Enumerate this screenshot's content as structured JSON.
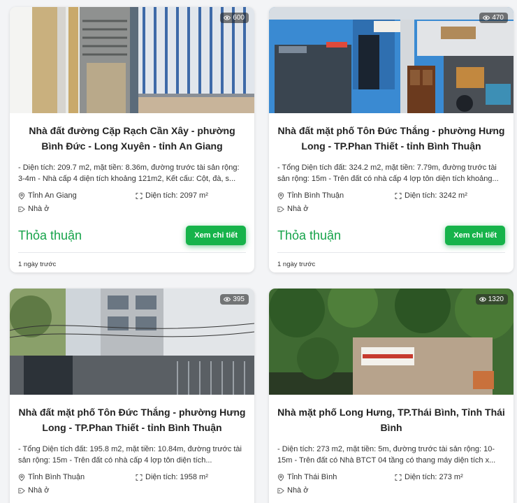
{
  "listings": [
    {
      "views": "600",
      "title": "Nhà đất đường Cặp Rạch Cần Xây - phường Bình Đức - Long Xuyên - tỉnh An Giang",
      "description": "- Diện tích: 209.7 m2, mặt tiền: 8.36m, đường trước tài sản rộng: 3-4m - Nhà cấp 4 diện tích khoảng 121m2, Kết cấu: Cột, đà, s...",
      "location": "Tỉnh An Giang",
      "area": "Diện tích: 2097 m²",
      "type": "Nhà ở",
      "price": "Thỏa thuận",
      "button": "Xem chi tiết",
      "time": "1 ngày trước"
    },
    {
      "views": "470",
      "title": "Nhà đất mặt phố Tôn Đức Thắng - phường Hưng Long - TP.Phan Thiết - tỉnh Bình Thuận",
      "description": "- Tổng Diện tích đất: 324.2 m2, mặt tiền: 7.79m, đường trước tài sản rộng: 15m - Trên đất có nhà cấp 4 lợp tôn diện tích khoảng...",
      "location": "Tỉnh Bình Thuận",
      "area": "Diện tích: 3242 m²",
      "type": "Nhà ở",
      "price": "Thỏa thuận",
      "button": "Xem chi tiết",
      "time": "1 ngày trước"
    },
    {
      "views": "395",
      "title": "Nhà đất mặt phố Tôn Đức Thắng - phường Hưng Long - TP.Phan Thiết - tỉnh Bình Thuận",
      "description": "- Tổng Diện tích đất: 195.8 m2, mặt tiền: 10.84m, đường trước tài sản rộng: 15m - Trên đất có nhà cấp 4 lợp tôn diện tích...",
      "location": "Tỉnh Bình Thuận",
      "area": "Diện tích: 1958 m²",
      "type": "Nhà ở"
    },
    {
      "views": "1320",
      "title": "Nhà mặt phố Long Hưng, TP.Thái Bình, Tỉnh Thái Bình",
      "description": "- Diện tích: 273 m2, mặt tiền: 5m, đường trước tài sản rộng: 10-15m - Trên đất có Nhà BTCT 04 tầng có thang máy diện tích x...",
      "location": "Tỉnh Thái Bình",
      "area": "Diện tích: 273 m²",
      "type": "Nhà ở"
    }
  ],
  "icons": {
    "views": "eye-icon",
    "location": "map-pin-icon",
    "area": "area-icon",
    "type": "tag-icon"
  },
  "colors": {
    "accent": "#16a34a",
    "button": "#16b34a"
  }
}
